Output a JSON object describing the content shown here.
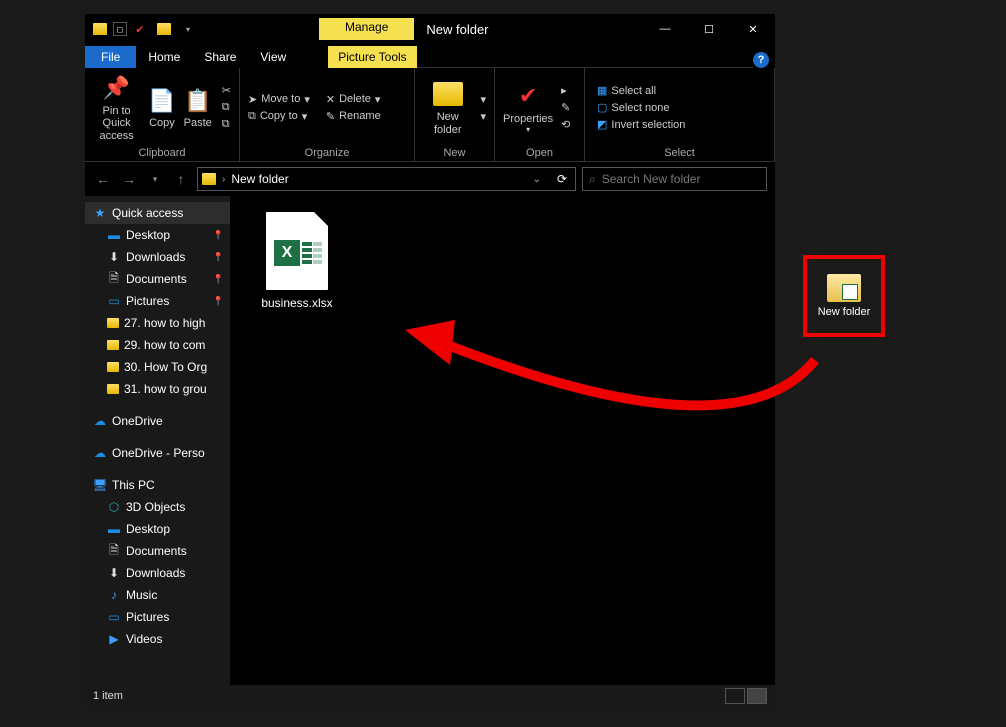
{
  "title": "New folder",
  "manage_tab": "Manage",
  "tabs": {
    "file": "File",
    "home": "Home",
    "share": "Share",
    "view": "View",
    "tools": "Picture Tools"
  },
  "ribbon": {
    "clipboard": {
      "label": "Clipboard",
      "pin": "Pin to Quick access",
      "copy": "Copy",
      "paste": "Paste"
    },
    "organize": {
      "label": "Organize",
      "moveto": "Move to",
      "copyto": "Copy to",
      "delete": "Delete",
      "rename": "Rename"
    },
    "new": {
      "label": "New",
      "newfolder": "New folder"
    },
    "open": {
      "label": "Open",
      "properties": "Properties"
    },
    "select": {
      "label": "Select",
      "all": "Select all",
      "none": "Select none",
      "invert": "Invert selection"
    }
  },
  "address": {
    "path": "New folder"
  },
  "search": {
    "placeholder": "Search New folder"
  },
  "sidebar": {
    "quick": "Quick access",
    "items1": [
      "Desktop",
      "Downloads",
      "Documents",
      "Pictures"
    ],
    "folders": [
      "27. how to high",
      "29. how to com",
      "30. How To Org",
      "31. how to grou"
    ],
    "onedrive": "OneDrive",
    "onedrivep": "OneDrive - Perso",
    "thispc": "This PC",
    "pcitems": [
      "3D Objects",
      "Desktop",
      "Documents",
      "Downloads",
      "Music",
      "Pictures",
      "Videos"
    ]
  },
  "file": {
    "name": "business.xlsx"
  },
  "status": {
    "count": "1 item"
  },
  "desktop_item": "New folder"
}
